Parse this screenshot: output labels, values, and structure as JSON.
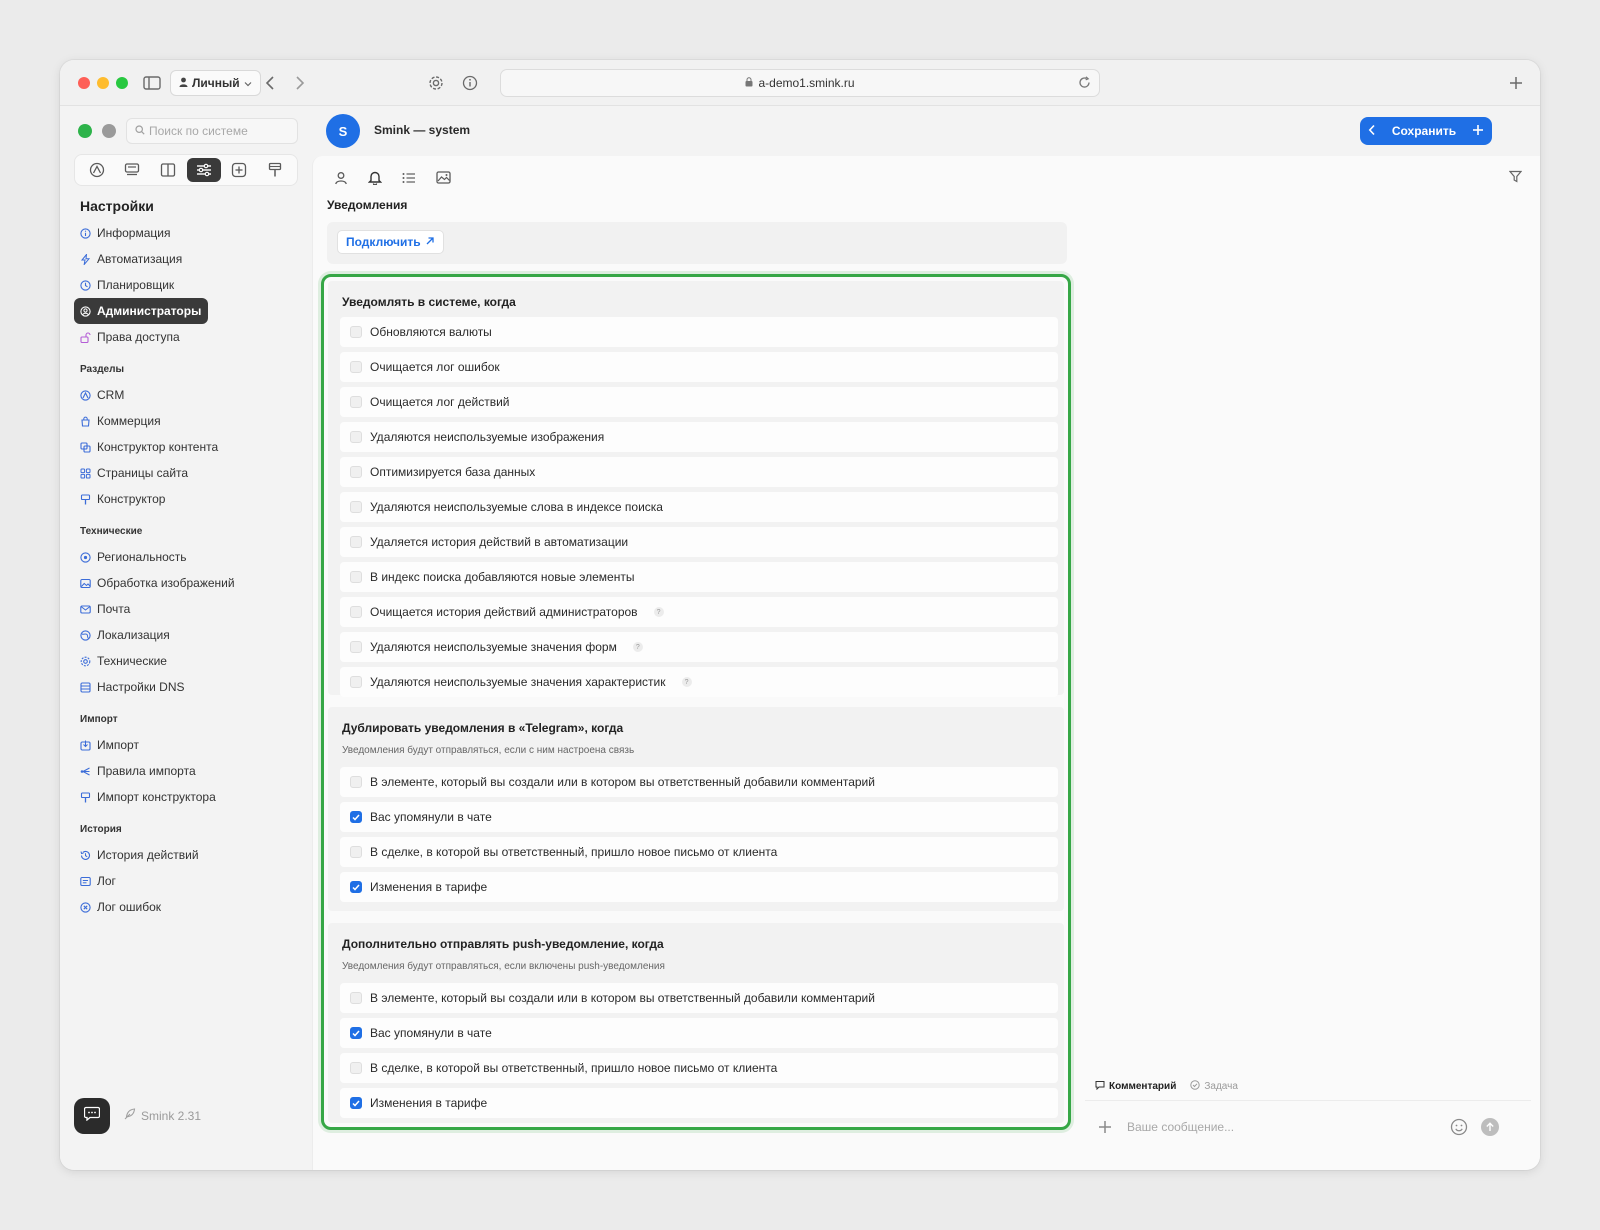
{
  "browser": {
    "profile_label": "Личный",
    "url": "a-demo1.smink.ru"
  },
  "sidebar": {
    "search_placeholder": "Поиск по системе",
    "settings_title": "Настройки",
    "settings_items": [
      {
        "label": "Информация",
        "icon": "info-icon"
      },
      {
        "label": "Автоматизация",
        "icon": "lightning-icon"
      },
      {
        "label": "Планировщик",
        "icon": "clock-icon"
      },
      {
        "label": "Администраторы",
        "icon": "user-circle-icon",
        "active": true
      },
      {
        "label": "Права доступа",
        "icon": "lock-icon"
      }
    ],
    "sections": [
      {
        "title": "Разделы",
        "items": [
          {
            "label": "CRM",
            "icon": "crm-icon"
          },
          {
            "label": "Коммерция",
            "icon": "bag-icon"
          },
          {
            "label": "Конструктор контента",
            "icon": "content-builder-icon"
          },
          {
            "label": "Страницы сайта",
            "icon": "pages-icon"
          },
          {
            "label": "Конструктор",
            "icon": "builder-icon"
          }
        ]
      },
      {
        "title": "Технические",
        "items": [
          {
            "label": "Региональность",
            "icon": "location-icon"
          },
          {
            "label": "Обработка изображений",
            "icon": "image-icon"
          },
          {
            "label": "Почта",
            "icon": "mail-icon"
          },
          {
            "label": "Локализация",
            "icon": "globe-icon"
          },
          {
            "label": "Технические",
            "icon": "gear-icon"
          },
          {
            "label": "Настройки DNS",
            "icon": "dns-icon"
          }
        ]
      },
      {
        "title": "Импорт",
        "items": [
          {
            "label": "Импорт",
            "icon": "import-icon"
          },
          {
            "label": "Правила импорта",
            "icon": "rules-icon"
          },
          {
            "label": "Импорт конструктора",
            "icon": "builder-import-icon"
          }
        ]
      },
      {
        "title": "История",
        "items": [
          {
            "label": "История действий",
            "icon": "history-icon"
          },
          {
            "label": "Лог",
            "icon": "log-icon"
          },
          {
            "label": "Лог ошибок",
            "icon": "error-icon"
          }
        ]
      }
    ],
    "version": "Smink 2.31"
  },
  "header": {
    "avatar_letter": "S",
    "app_name": "Smink — system",
    "save_label": "Сохранить"
  },
  "main": {
    "section_label": "Уведомления",
    "connect_label": "Подключить",
    "groups": [
      {
        "title": "Уведомлять в системе, когда",
        "subtitle": "",
        "items": [
          {
            "label": "Обновляются валюты",
            "checked": false,
            "help": false
          },
          {
            "label": "Очищается лог ошибок",
            "checked": false,
            "help": false
          },
          {
            "label": "Очищается лог действий",
            "checked": false,
            "help": false
          },
          {
            "label": "Удаляются неиспользуемые изображения",
            "checked": false,
            "help": false
          },
          {
            "label": "Оптимизируется база данных",
            "checked": false,
            "help": false
          },
          {
            "label": "Удаляются неиспользуемые слова в индексе поиска",
            "checked": false,
            "help": false
          },
          {
            "label": "Удаляется история действий в автоматизации",
            "checked": false,
            "help": false
          },
          {
            "label": "В индекс поиска добавляются новые элементы",
            "checked": false,
            "help": false
          },
          {
            "label": "Очищается история действий администраторов",
            "checked": false,
            "help": true
          },
          {
            "label": "Удаляются неиспользуемые значения форм",
            "checked": false,
            "help": true
          },
          {
            "label": "Удаляются неиспользуемые значения характеристик",
            "checked": false,
            "help": true
          }
        ]
      },
      {
        "title": "Дублировать уведомления в «Telegram», когда",
        "subtitle": "Уведомления будут отправляться, если с ним настроена связь",
        "items": [
          {
            "label": "В элементе, который вы создали или в котором вы ответственный добавили комментарий",
            "checked": false,
            "help": false
          },
          {
            "label": "Вас упомянули в чате",
            "checked": true,
            "help": false
          },
          {
            "label": "В сделке, в которой вы ответственный, пришло новое письмо от клиента",
            "checked": false,
            "help": false
          },
          {
            "label": "Изменения в тарифе",
            "checked": true,
            "help": false
          }
        ]
      },
      {
        "title": "Дополнительно отправлять push-уведомление, когда",
        "subtitle": "Уведомления будут отправляться, если включены push-уведомления",
        "items": [
          {
            "label": "В элементе, который вы создали или в котором вы ответственный добавили комментарий",
            "checked": false,
            "help": false
          },
          {
            "label": "Вас упомянули в чате",
            "checked": true,
            "help": false
          },
          {
            "label": "В сделке, в которой вы ответственный, пришло новое письмо от клиента",
            "checked": false,
            "help": false
          },
          {
            "label": "Изменения в тарифе",
            "checked": true,
            "help": false
          }
        ]
      }
    ]
  },
  "comments": {
    "tab_comment": "Комментарий",
    "tab_task": "Задача",
    "input_placeholder": "Ваше сообщение..."
  },
  "colors": {
    "accent": "#1f6fe5",
    "frame": "#36a746",
    "active_nav": "#3a3a3a"
  }
}
